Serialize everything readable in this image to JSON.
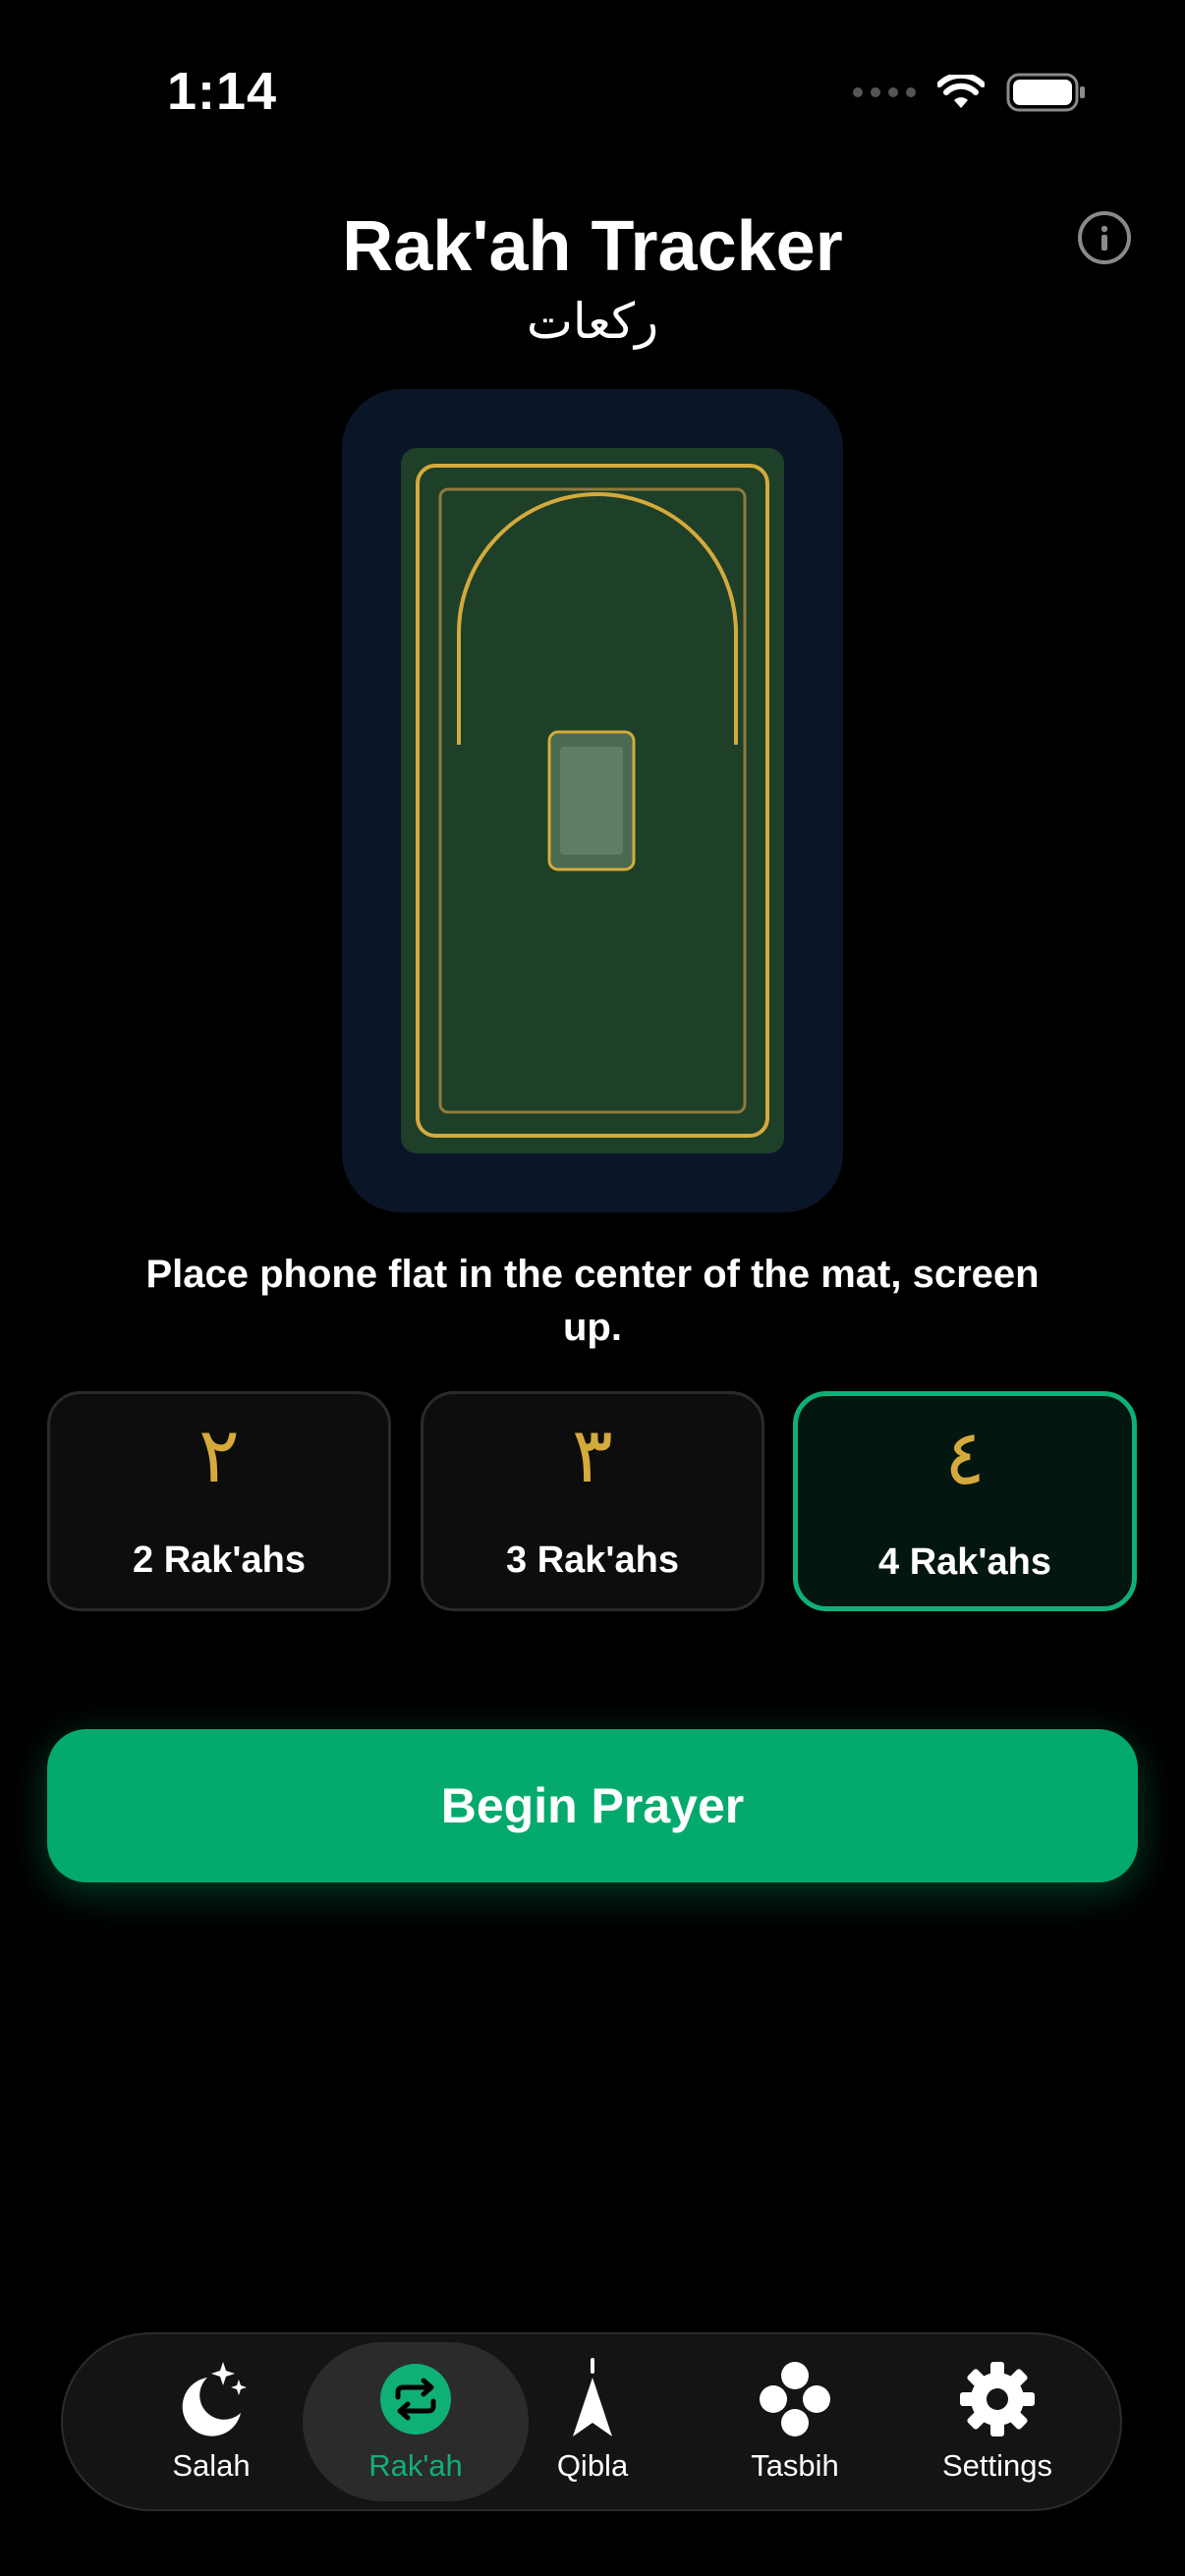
{
  "status_bar": {
    "time": "1:14",
    "icons": [
      "cellular-signal-icon",
      "wifi-icon",
      "battery-icon"
    ]
  },
  "header": {
    "title": "Rak'ah Tracker",
    "subtitle_arabic": "ركعات",
    "info_icon": "info-icon"
  },
  "instruction": "Place phone flat in the center of the mat, screen up.",
  "options": [
    {
      "numeral": "٢",
      "label": "2 Rak'ahs",
      "selected": false
    },
    {
      "numeral": "٣",
      "label": "3 Rak'ahs",
      "selected": false
    },
    {
      "numeral": "٤",
      "label": "4 Rak'ahs",
      "selected": true
    }
  ],
  "begin_button": {
    "label": "Begin Prayer"
  },
  "tabs": [
    {
      "label": "Salah",
      "icon": "moon-stars-icon",
      "active": false
    },
    {
      "label": "Rak'ah",
      "icon": "repeat-icon",
      "active": true
    },
    {
      "label": "Qibla",
      "icon": "compass-arrow-icon",
      "active": false
    },
    {
      "label": "Tasbih",
      "icon": "beads-icon",
      "active": false
    },
    {
      "label": "Settings",
      "icon": "gear-icon",
      "active": false
    }
  ],
  "colors": {
    "background": "#000000",
    "accent_green": "#04AA6D",
    "gold": "#D4AA3C",
    "mat_green": "#1E3F28",
    "mat_card": "#0B1528",
    "text": "#FFFFFF",
    "muted": "#8A8A8A"
  }
}
